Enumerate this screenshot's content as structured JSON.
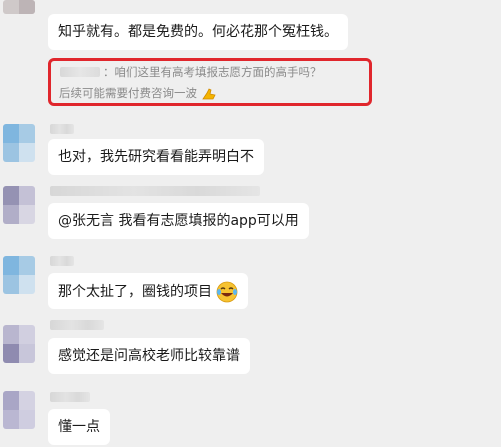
{
  "messages": [
    {
      "text": "知乎就有。都是免费的。何必花那个冤枉钱。"
    },
    {
      "text": "也对，我先研究看看能弄明白不"
    },
    {
      "text": "@张无言 我看有志愿填报的app可以用"
    },
    {
      "text": "那个太扯了，圈钱的项目"
    },
    {
      "text": "感觉还是问高校老师比较靠谱"
    },
    {
      "text": "懂一点"
    }
  ],
  "quote": {
    "line1": "：咱们这里有高考填报志愿方面的高手吗？",
    "line2": "后续可能需要付费咨询一波"
  },
  "colors": {
    "highlight": "#e0262c",
    "background": "#efefef",
    "bubble": "#ffffff"
  },
  "icons": [
    "laughing-crying-emoji-icon",
    "thumb-emoji-icon"
  ]
}
